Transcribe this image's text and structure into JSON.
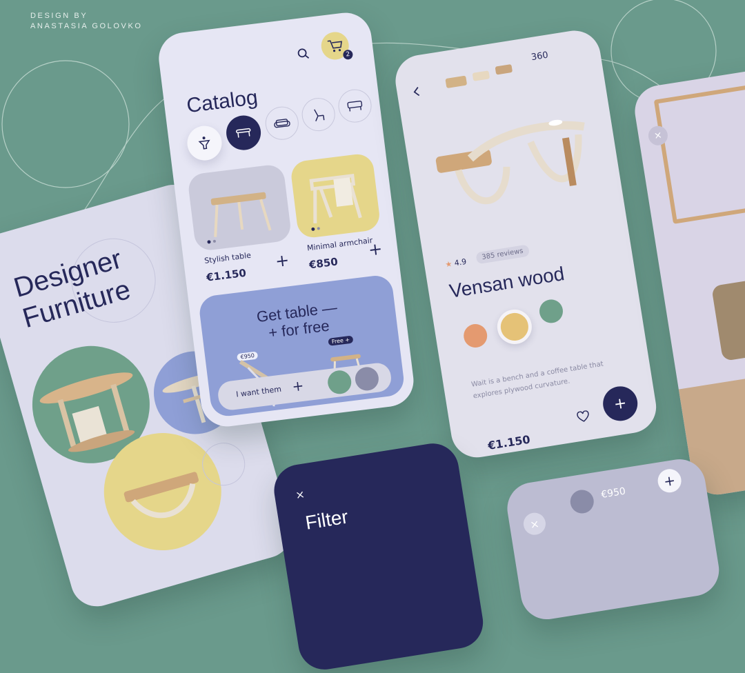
{
  "credit": {
    "line1": "DESIGN BY",
    "line2": "ANASTASIA GOLOVKO"
  },
  "colors": {
    "background": "#6a9a8c",
    "navy": "#26285a",
    "lavender": "#dcdcf0",
    "yellow": "#e5d68a",
    "periwinkle": "#8f9fd6",
    "green": "#6fa08a",
    "orange": "#e49a70"
  },
  "intro": {
    "title_line1": "Designer",
    "title_line2": "Furniture"
  },
  "catalog": {
    "title": "Catalog",
    "cart_count": "2",
    "categories": [
      "filter-icon",
      "table-icon",
      "sofa-icon",
      "chair-icon",
      "bench-icon"
    ],
    "products": [
      {
        "name": "Stylish table",
        "price": "€1.150"
      },
      {
        "name": "Minimal armchair",
        "price": "€850"
      }
    ],
    "promo": {
      "line1": "Get table —",
      "line2": "+ for free",
      "price_tag": "€950",
      "free_tag": "Free +",
      "cta": "I want them"
    }
  },
  "detail": {
    "rating": "4.9",
    "reviews": "385 reviews",
    "name": "Vensan wood",
    "description_line1": "Wait is a bench and a coffee table that",
    "description_line2": "explores plywood curvature.",
    "price": "€1.150",
    "rotate_label": "360"
  },
  "filter": {
    "title": "Filter",
    "close": "×"
  },
  "cart_sheet": {
    "price": "€950"
  }
}
